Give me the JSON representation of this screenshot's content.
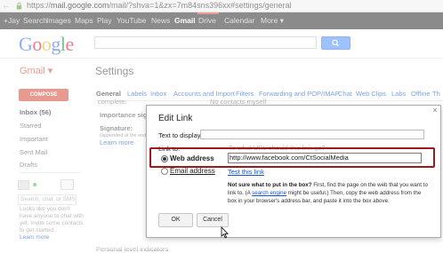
{
  "browser": {
    "url_prefix": "https://",
    "url_host": "mail.google.com",
    "url_path": "/mail/?shva=1&zx=7m84sns396xx#settings/general",
    "lock_icon": "lock-icon",
    "back_icon": "back-arrow-icon"
  },
  "google_bar": {
    "items": [
      "+Jay",
      "Search",
      "Images",
      "Maps",
      "Play",
      "YouTube",
      "News",
      "Gmail",
      "Drive",
      "Calendar",
      "More ▾"
    ],
    "active_item": "Gmail",
    "accent_color": "#dd4b39"
  },
  "header": {
    "logo_letters": [
      "G",
      "o",
      "o",
      "g",
      "l",
      "e"
    ],
    "logo_colors": [
      "#3369e8",
      "#d50f25",
      "#eeb211",
      "#3369e8",
      "#009925",
      "#d50f25"
    ],
    "search_icon": "search-icon"
  },
  "app": {
    "gmail_label": "Gmail ▾",
    "settings_title": "Settings"
  },
  "sidebar": {
    "compose_label": "COMPOSE",
    "items": [
      {
        "label": "Inbox (56)",
        "bold": true
      },
      {
        "label": "Starred",
        "bold": false
      },
      {
        "label": "Important",
        "bold": false
      },
      {
        "label": "Sent Mail",
        "bold": false
      },
      {
        "label": "Drafts",
        "bold": false
      }
    ],
    "chat_search_placeholder": "Search, chat, or SMS",
    "chat_message": "Looks like you don't have anyone to chat with yet. Invite some contacts to get started.",
    "chat_link": "Learn more"
  },
  "settings": {
    "tabs": [
      "General",
      "Labels",
      "Inbox",
      "Accounts and Import",
      "Filters",
      "Forwarding and POP/IMAP",
      "Chat",
      "Web Clips",
      "Labs",
      "Offline",
      "Th"
    ],
    "active_tab": "General",
    "bg_complete": "complete:",
    "bg_no_contacts": "No contacts myself",
    "bg_importance": "Importance sig",
    "bg_signature": "Signature:",
    "bg_signature_sub": "(appended at the end of all",
    "bg_learn_more": "Learn more",
    "bg_personal": "Personal level indicators"
  },
  "dialog": {
    "title": "Edit Link",
    "close_icon": "close-icon",
    "text_to_display_label": "Text to display:",
    "text_to_display_value": "",
    "link_to_label": "Link to:",
    "faded_question": "To what URL should this link go?",
    "web_address_label": "Web address",
    "web_address_value": "http://www.facebook.com/CtSocialMedia",
    "email_label": "Email address",
    "test_link": "Test this link",
    "help_bold": "Not sure what to put in the box?",
    "help_text_1": " First, find the page on the web that you want to link to. (A ",
    "help_link": "search engine",
    "help_text_2": " might be useful.) Then, copy the web address from the box in your browser's address bar, and paste it into the box above.",
    "ok_label": "OK",
    "cancel_label": "Cancel",
    "highlight_color": "#9b1b1b"
  }
}
